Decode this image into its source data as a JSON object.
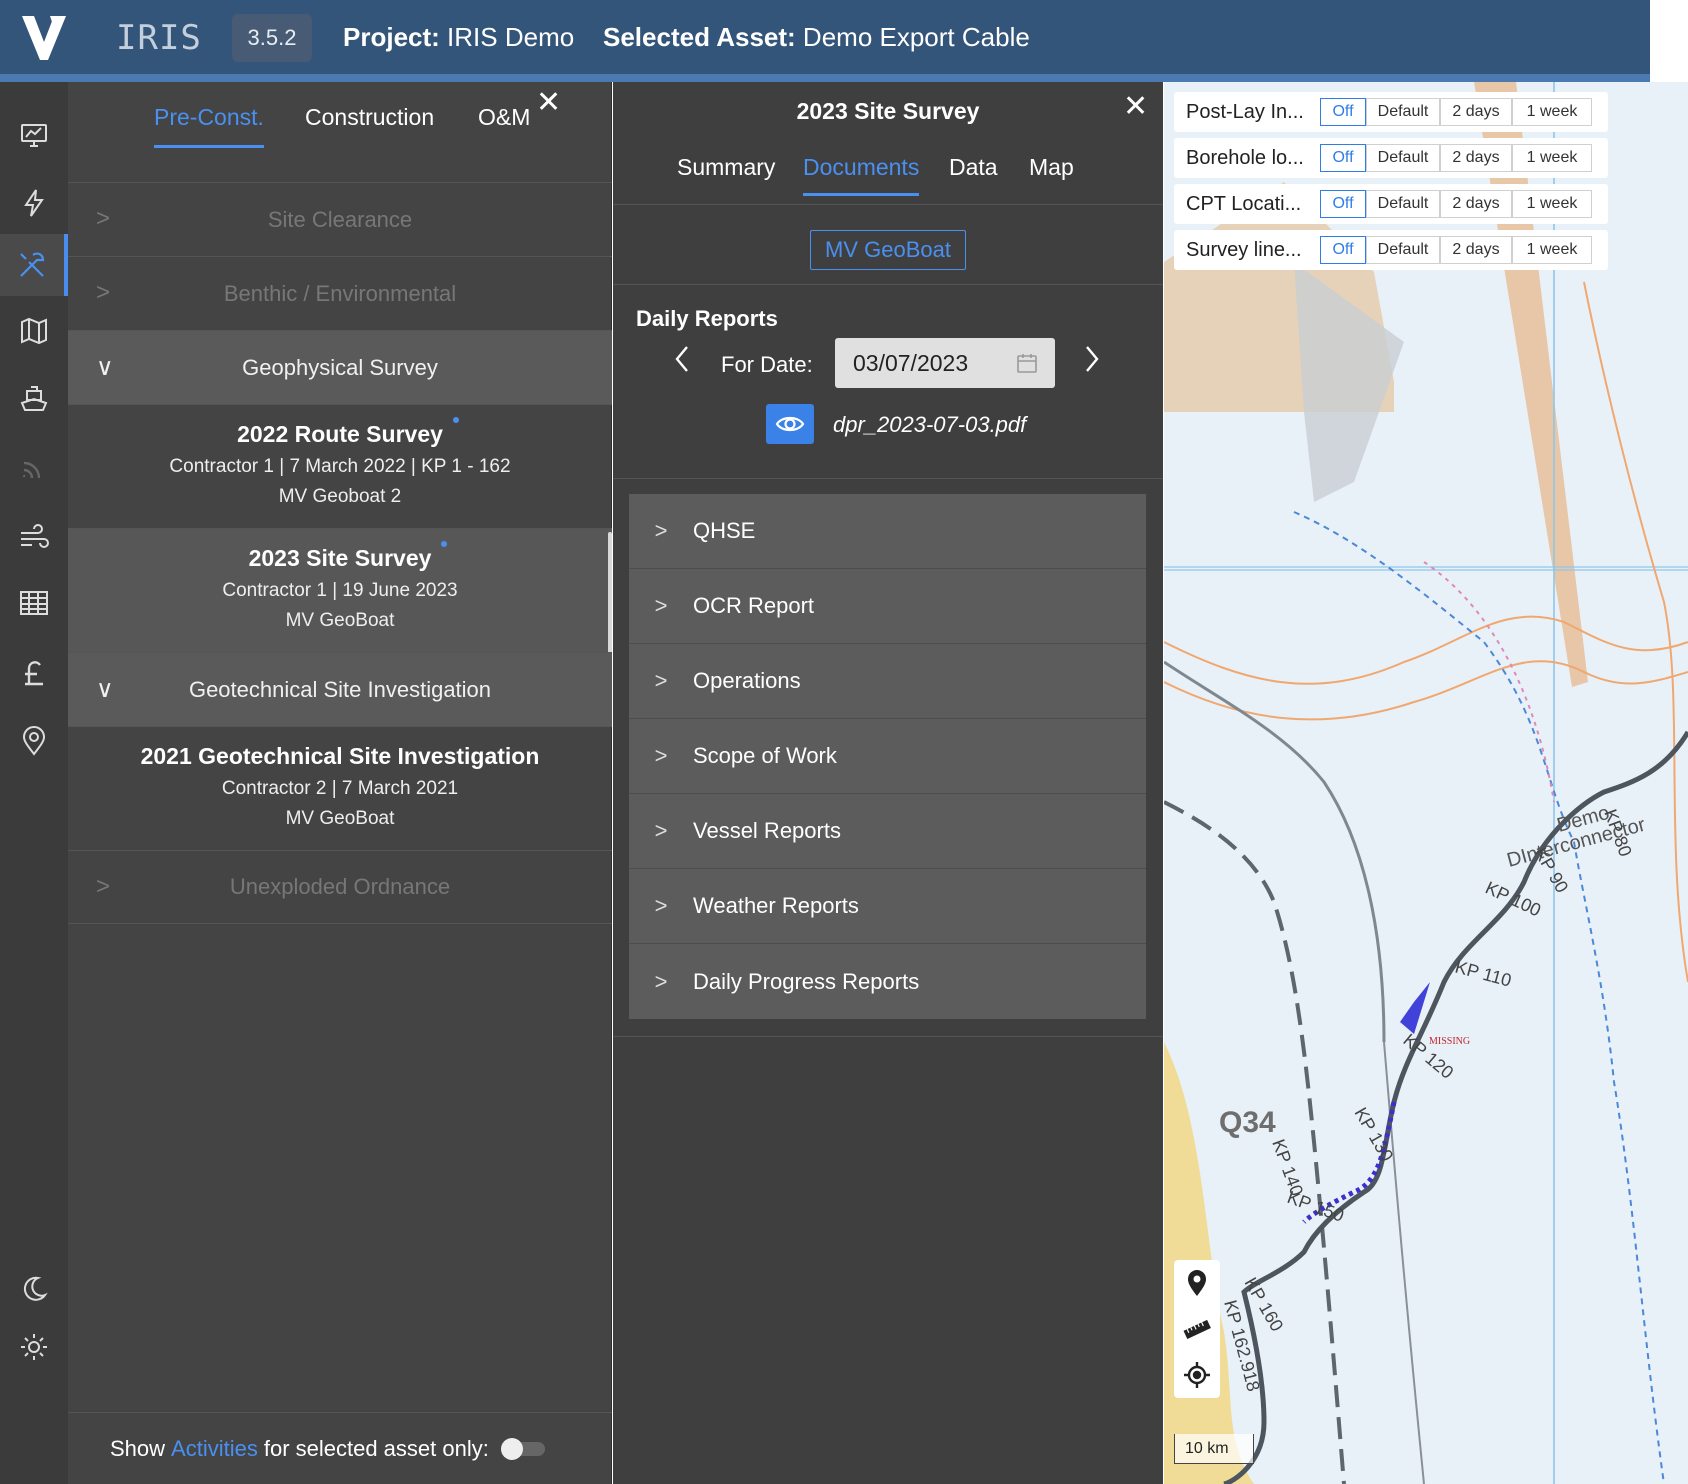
{
  "header": {
    "app_name": "IRIS",
    "version": "3.5.2",
    "project_label": "Project:",
    "project_value": "IRIS Demo",
    "asset_label": "Selected Asset:",
    "asset_value": "Demo Export Cable",
    "colors": {
      "bar": "#34557a",
      "accent_line": "#4a7ab0"
    }
  },
  "rail": {
    "icons": [
      "monitor-chart-icon",
      "lightning-icon",
      "tools-icon",
      "map-icon",
      "vessel-icon",
      "signal-icon",
      "wind-icon",
      "table-icon",
      "pound-icon",
      "location-pin-icon",
      "moon-icon",
      "gear-icon"
    ],
    "active_index": 2
  },
  "left_panel": {
    "tabs": [
      {
        "label": "Pre-Const.",
        "active": true
      },
      {
        "label": "Construction",
        "active": false
      },
      {
        "label": "O&M",
        "active": false
      }
    ],
    "close_symbol": "✕",
    "sections": [
      {
        "label": "Site Clearance",
        "chevron": ">",
        "open": false
      },
      {
        "label": "Benthic / Environmental",
        "chevron": ">",
        "open": false
      },
      {
        "label": "Geophysical Survey",
        "chevron": "∨",
        "open": true
      },
      {
        "label": "Geotechnical Site Investigation",
        "chevron": "∨",
        "open": true
      },
      {
        "label": "Unexploded Ordnance",
        "chevron": ">",
        "open": false
      }
    ],
    "surveys": [
      {
        "title": "2022 Route Survey",
        "line1": "Contractor 1 | 7 March 2022 | KP 1 - 162",
        "line2": "MV Geoboat 2",
        "dot": true,
        "selected": false
      },
      {
        "title": "2023 Site Survey",
        "line1": "Contractor 1 | 19 June 2023",
        "line2": "MV GeoBoat",
        "dot": true,
        "selected": true
      },
      {
        "title": "2021 Geotechnical Site Investigation",
        "line1": "Contractor 2 | 7 March 2021",
        "line2": "MV GeoBoat",
        "dot": false,
        "selected": false
      }
    ],
    "footer": {
      "prefix": "Show",
      "link": "Activities",
      "suffix": "for selected asset only:",
      "toggle_on": false
    }
  },
  "mid_panel": {
    "title": "2023 Site Survey",
    "close_symbol": "✕",
    "tabs": [
      {
        "label": "Summary",
        "active": false
      },
      {
        "label": "Documents",
        "active": true
      },
      {
        "label": "Data",
        "active": false
      },
      {
        "label": "Map",
        "active": false
      }
    ],
    "vessel_button": "MV GeoBoat",
    "daily_reports_title": "Daily Reports",
    "for_date_label": "For Date:",
    "date_value": "03/07/2023",
    "prev_symbol": "<",
    "next_symbol": ">",
    "pdf_name": "dpr_2023-07-03.pdf",
    "documents": [
      "QHSE",
      "OCR Report",
      "Operations",
      "Scope of Work",
      "Vessel Reports",
      "Weather Reports",
      "Daily Progress Reports"
    ]
  },
  "map": {
    "layers": [
      {
        "name": "Post-Lay In...",
        "options": [
          "Off",
          "Default",
          "2 days",
          "1 week"
        ],
        "selected": "Off"
      },
      {
        "name": "Borehole lo...",
        "options": [
          "Off",
          "Default",
          "2 days",
          "1 week"
        ],
        "selected": "Off"
      },
      {
        "name": "CPT Locati...",
        "options": [
          "Off",
          "Default",
          "2 days",
          "1 week"
        ],
        "selected": "Off"
      },
      {
        "name": "Survey line...",
        "options": [
          "Off",
          "Default",
          "2 days",
          "1 week"
        ],
        "selected": "Off"
      }
    ],
    "labels": {
      "area": "Q34",
      "cable_name_1": "Demo",
      "cable_name_2": "DInterconnector",
      "kp": [
        "KP 80",
        "KP 90",
        "KP 100",
        "KP 110",
        "KP 120",
        "KP 130",
        "KP 140",
        "KP 150",
        "KP 160",
        "KP 162.918"
      ],
      "missing": "MISSING"
    },
    "tools": [
      "pin-icon",
      "ruler-icon",
      "crosshair-icon"
    ],
    "scale_label": "10 km"
  }
}
